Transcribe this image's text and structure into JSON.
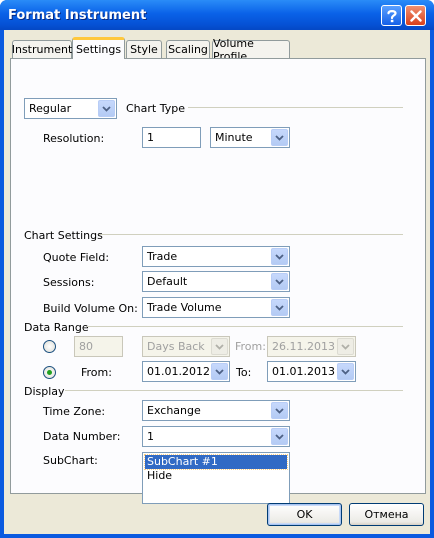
{
  "window": {
    "title": "Format Instrument",
    "help_icon": "help-icon",
    "close_icon": "close-icon"
  },
  "tabs": [
    {
      "label": "Instrument",
      "active": false
    },
    {
      "label": "Settings",
      "active": true
    },
    {
      "label": "Style",
      "active": false
    },
    {
      "label": "Scaling",
      "active": false
    },
    {
      "label": "Volume Profile",
      "active": false
    }
  ],
  "chart_type": {
    "type_select": "Regular",
    "section_label": "Chart Type",
    "resolution_label": "Resolution:",
    "resolution_value": "1",
    "resolution_unit": "Minute"
  },
  "chart_settings": {
    "section_label": "Chart Settings",
    "quote_field_label": "Quote Field:",
    "quote_field_value": "Trade",
    "sessions_label": "Sessions:",
    "sessions_value": "Default",
    "build_volume_label": "Build Volume On:",
    "build_volume_value": "Trade Volume"
  },
  "data_range": {
    "section_label": "Data Range",
    "days_back_selected": false,
    "days_back_value": "80",
    "days_back_unit": "Days Back",
    "from_disabled_label": "From:",
    "from_disabled_value": "26.11.2013",
    "from_selected": true,
    "from_label": "From:",
    "from_value": "01.01.2012",
    "to_label": "To:",
    "to_value": "01.01.2013"
  },
  "display": {
    "section_label": "Display",
    "time_zone_label": "Time Zone:",
    "time_zone_value": "Exchange",
    "data_number_label": "Data Number:",
    "data_number_value": "1",
    "subchart_label": "SubChart:",
    "subchart_options": [
      "SubChart #1",
      "Hide"
    ],
    "subchart_selected": "SubChart #1"
  },
  "buttons": {
    "ok": "OK",
    "cancel": "Отмена"
  },
  "colors": {
    "title_bar": "#0a5ae0",
    "close_button": "#d8401c",
    "selection": "#316ac5",
    "active_tab_marker": "#ffc83c",
    "radio_dot": "#21a121"
  }
}
